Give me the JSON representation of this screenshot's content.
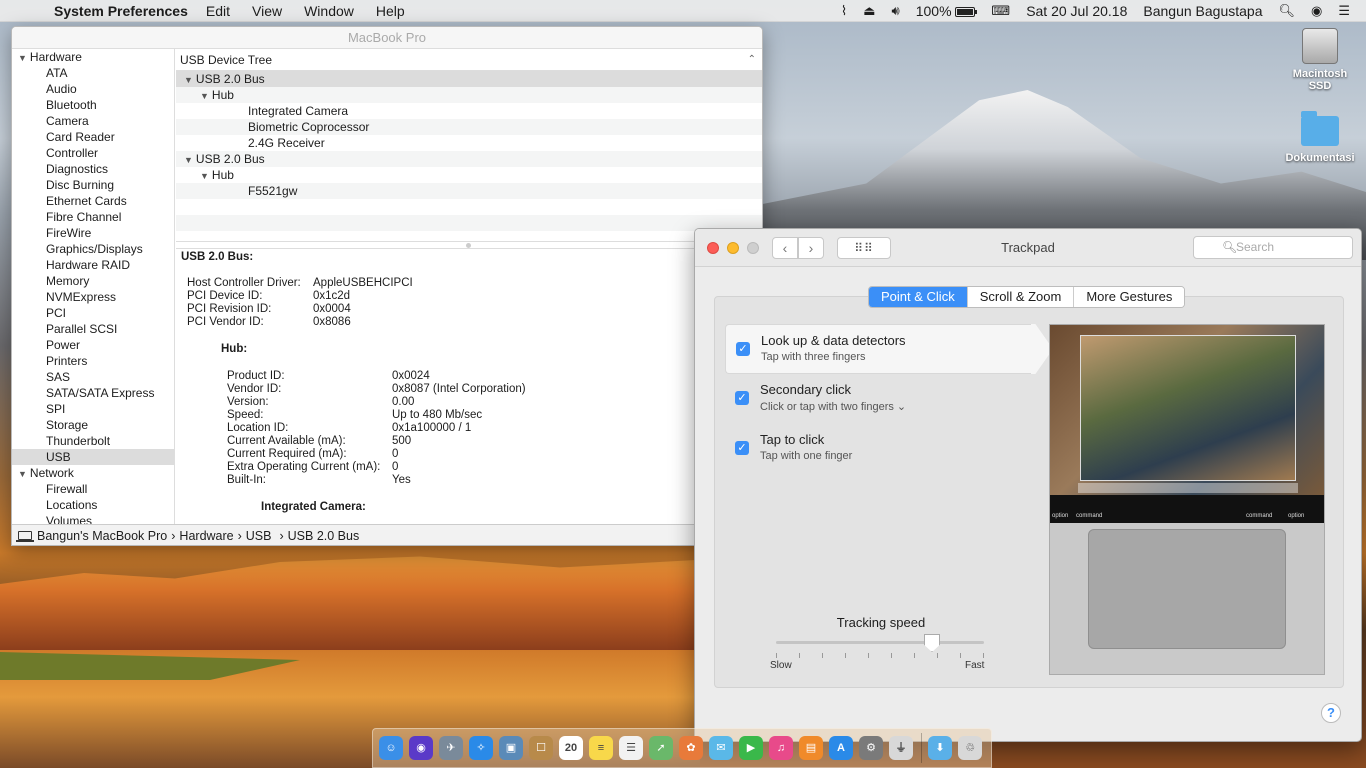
{
  "menubar": {
    "app_name": "System Preferences",
    "menus": [
      "Edit",
      "View",
      "Window",
      "Help"
    ],
    "battery": "100%",
    "clock": "Sat 20 Jul  20.18",
    "user": "Bangun Bagustapa"
  },
  "desktop": {
    "icons": [
      {
        "label": "Macintosh SSD",
        "icon": "hard-drive-icon"
      },
      {
        "label": "Dokumentasi",
        "icon": "folder-icon"
      }
    ]
  },
  "sysinfo": {
    "title": "MacBook Pro",
    "sidebar": {
      "hardware_label": "Hardware",
      "hardware_items": [
        "ATA",
        "Audio",
        "Bluetooth",
        "Camera",
        "Card Reader",
        "Controller",
        "Diagnostics",
        "Disc Burning",
        "Ethernet Cards",
        "Fibre Channel",
        "FireWire",
        "Graphics/Displays",
        "Hardware RAID",
        "Memory",
        "NVMExpress",
        "PCI",
        "Parallel SCSI",
        "Power",
        "Printers",
        "SAS",
        "SATA/SATA Express",
        "SPI",
        "Storage",
        "Thunderbolt",
        "USB"
      ],
      "selected": "USB",
      "network_label": "Network",
      "network_items": [
        "Firewall",
        "Locations",
        "Volumes"
      ]
    },
    "tree": {
      "header": "USB Device Tree",
      "rows": [
        {
          "label": "USB 2.0 Bus",
          "level": 0,
          "expandable": true
        },
        {
          "label": "Hub",
          "level": 1,
          "expandable": true
        },
        {
          "label": "Integrated Camera",
          "level": 2,
          "expandable": false
        },
        {
          "label": "Biometric Coprocessor",
          "level": 2,
          "expandable": false
        },
        {
          "label": "2.4G Receiver",
          "level": 2,
          "expandable": false
        },
        {
          "label": "USB 2.0 Bus",
          "level": 0,
          "expandable": true
        },
        {
          "label": "Hub",
          "level": 1,
          "expandable": true
        },
        {
          "label": "F5521gw",
          "level": 2,
          "expandable": false
        },
        {
          "label": "",
          "level": 0,
          "expandable": false
        },
        {
          "label": "",
          "level": 0,
          "expandable": false
        }
      ]
    },
    "detail": {
      "title": "USB 2.0 Bus:",
      "bus_props": [
        {
          "k": "Host Controller Driver:",
          "v": "AppleUSBEHCIPCI"
        },
        {
          "k": "PCI Device ID:",
          "v": "0x1c2d"
        },
        {
          "k": "PCI Revision ID:",
          "v": "0x0004"
        },
        {
          "k": "PCI Vendor ID:",
          "v": "0x8086"
        }
      ],
      "hub_title": "Hub:",
      "hub_props": [
        {
          "k": "Product ID:",
          "v": "0x0024"
        },
        {
          "k": "Vendor ID:",
          "v": "0x8087  (Intel Corporation)"
        },
        {
          "k": "Version:",
          "v": "0.00"
        },
        {
          "k": "Speed:",
          "v": "Up to 480 Mb/sec"
        },
        {
          "k": "Location ID:",
          "v": "0x1a100000 / 1"
        },
        {
          "k": "Current Available (mA):",
          "v": "500"
        },
        {
          "k": "Current Required (mA):",
          "v": "0"
        },
        {
          "k": "Extra Operating Current (mA):",
          "v": "0"
        },
        {
          "k": "Built-In:",
          "v": "Yes"
        }
      ],
      "camera_title": "Integrated Camera:"
    },
    "pathbar": {
      "computer": "Bangun's MacBook Pro",
      "crumbs": [
        "Hardware",
        "USB",
        "USB 2.0 Bus"
      ]
    }
  },
  "trackpad": {
    "title": "Trackpad",
    "search_placeholder": "Search",
    "grid_label": "⠿⠿",
    "tabs": [
      {
        "label": "Point & Click",
        "active": true
      },
      {
        "label": "Scroll & Zoom",
        "active": false
      },
      {
        "label": "More Gestures",
        "active": false
      }
    ],
    "options": [
      {
        "title": "Look up & data detectors",
        "subtitle": "Tap with three fingers",
        "checked": true,
        "selected": true
      },
      {
        "title": "Secondary click",
        "subtitle": "Click or tap with two fingers ⌄",
        "checked": true,
        "selected": false
      },
      {
        "title": "Tap to click",
        "subtitle": "Tap with one finger",
        "checked": true,
        "selected": false
      }
    ],
    "tracking": {
      "label": "Tracking speed",
      "slow": "Slow",
      "fast": "Fast",
      "value": 0.75,
      "ticks": 10
    },
    "preview_keys": [
      "option",
      "command",
      "command",
      "option"
    ],
    "help": "?"
  },
  "dock": {
    "apps": [
      {
        "name": "finder",
        "color": "#3a8fe8",
        "glyph": "☺"
      },
      {
        "name": "siri",
        "color": "#5a3ac8",
        "glyph": "◉"
      },
      {
        "name": "launchpad",
        "color": "#7a8a9a",
        "glyph": "✈"
      },
      {
        "name": "safari",
        "color": "#2a8ae8",
        "glyph": "✧"
      },
      {
        "name": "preview",
        "color": "#5a8ab8",
        "glyph": "▣"
      },
      {
        "name": "contacts",
        "color": "#b88a4a",
        "glyph": "☐"
      },
      {
        "name": "calendar",
        "color": "#ffffff",
        "glyph": "20"
      },
      {
        "name": "notes",
        "color": "#f8d84a",
        "glyph": "≡"
      },
      {
        "name": "reminders",
        "color": "#f2f2f2",
        "glyph": "☰"
      },
      {
        "name": "maps",
        "color": "#6ab86a",
        "glyph": "➚"
      },
      {
        "name": "photos",
        "color": "#e87a3a",
        "glyph": "✿"
      },
      {
        "name": "messages",
        "color": "#5ab8e8",
        "glyph": "✉"
      },
      {
        "name": "facetime",
        "color": "#3ab84a",
        "glyph": "▶"
      },
      {
        "name": "itunes",
        "color": "#e84a8a",
        "glyph": "♫"
      },
      {
        "name": "ibooks",
        "color": "#f08a2a",
        "glyph": "▤"
      },
      {
        "name": "app-store",
        "color": "#2a8ae8",
        "glyph": "A"
      },
      {
        "name": "system-preferences",
        "color": "#7a7a7a",
        "glyph": "⚙"
      },
      {
        "name": "usb-utility",
        "color": "#d8d8d8",
        "glyph": "⏚"
      }
    ],
    "right": [
      {
        "name": "downloads-folder",
        "color": "#5ab0e8",
        "glyph": "⬇"
      },
      {
        "name": "trash",
        "color": "#d8d8d8",
        "glyph": "♲"
      }
    ]
  }
}
